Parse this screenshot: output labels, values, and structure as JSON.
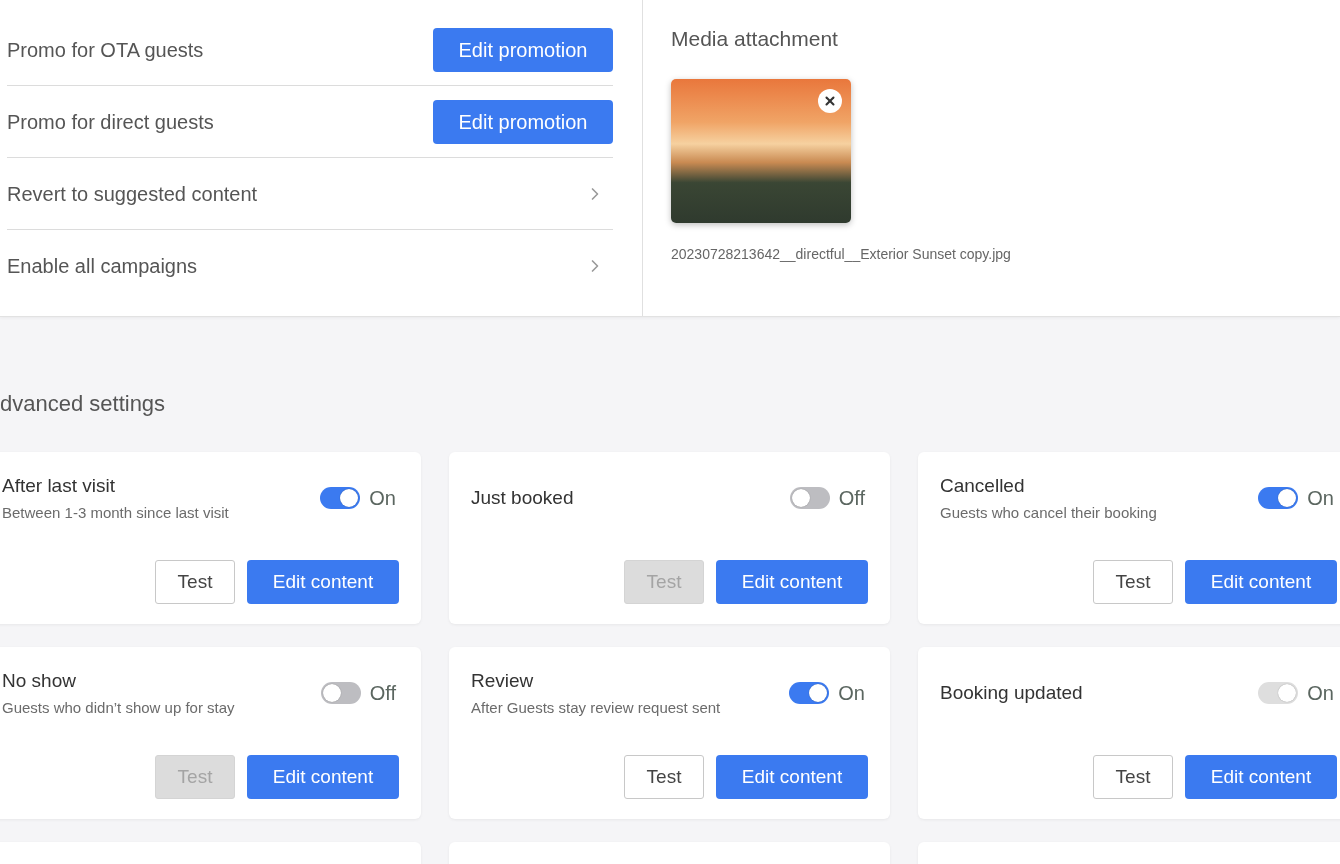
{
  "promotions": [
    {
      "kind": "button",
      "label": "Promo for OTA guests",
      "button": "Edit promotion"
    },
    {
      "kind": "button",
      "label": "Promo for direct guests",
      "button": "Edit promotion"
    },
    {
      "kind": "link",
      "label": "Revert to suggested content"
    },
    {
      "kind": "link",
      "label": "Enable all campaigns"
    }
  ],
  "media": {
    "title": "Media attachment",
    "file_name": "20230728213642__directful__Exterior Sunset copy.jpg"
  },
  "advanced_settings": {
    "title": "dvanced settings",
    "cards": [
      {
        "title": "After last visit",
        "subtitle": "Between 1-3 month since last visit",
        "toggle": {
          "on": true,
          "disabled": false,
          "label": "On"
        },
        "test": {
          "label": "Test",
          "disabled": false
        },
        "edit": "Edit content"
      },
      {
        "title": "Just booked",
        "toggle": {
          "on": false,
          "disabled": false,
          "label": "Off"
        },
        "test": {
          "label": "Test",
          "disabled": true
        },
        "edit": "Edit content"
      },
      {
        "title": "Cancelled",
        "subtitle": "Guests who cancel their booking",
        "toggle": {
          "on": true,
          "disabled": false,
          "label": "On"
        },
        "test": {
          "label": "Test",
          "disabled": false
        },
        "edit": "Edit content"
      },
      {
        "title": "No show",
        "subtitle": "Guests who didn’t show up for stay",
        "toggle": {
          "on": false,
          "disabled": false,
          "label": "Off"
        },
        "test": {
          "label": "Test",
          "disabled": true
        },
        "edit": "Edit content"
      },
      {
        "title": "Review",
        "subtitle": "After Guests stay review request sent",
        "toggle": {
          "on": true,
          "disabled": false,
          "label": "On"
        },
        "test": {
          "label": "Test",
          "disabled": false
        },
        "edit": "Edit content"
      },
      {
        "title": "Booking updated",
        "toggle": {
          "on": true,
          "disabled": true,
          "label": "On"
        },
        "test": {
          "label": "Test",
          "disabled": false
        },
        "edit": "Edit content"
      }
    ]
  }
}
